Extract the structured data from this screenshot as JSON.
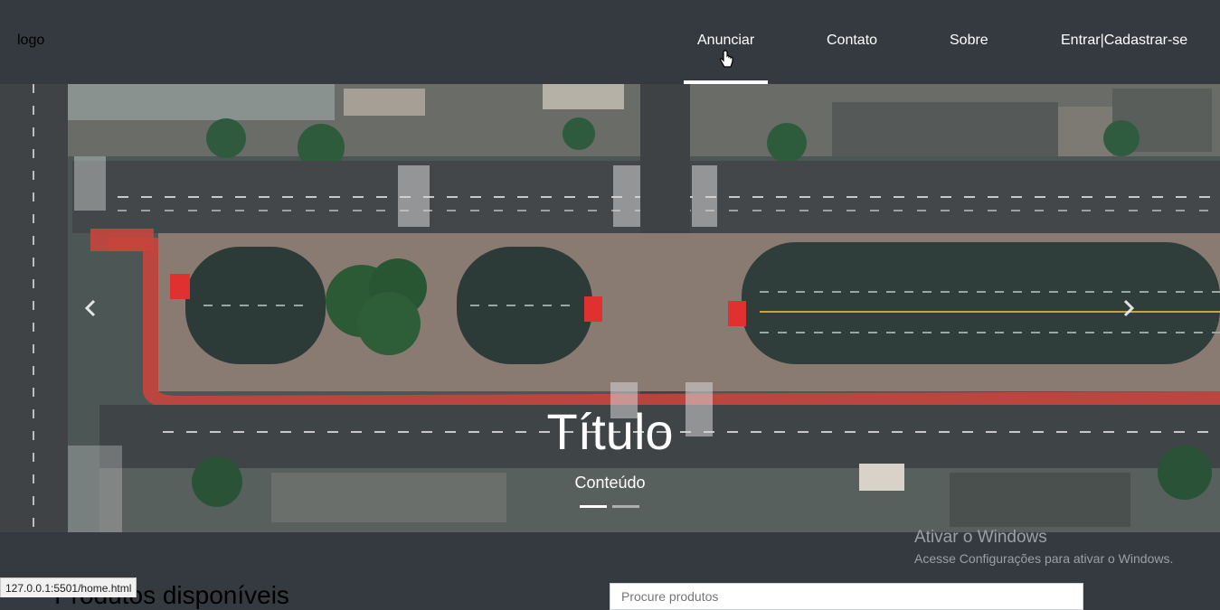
{
  "navbar": {
    "logo": "logo",
    "items": [
      {
        "label": "Anunciar",
        "active": true
      },
      {
        "label": "Contato"
      },
      {
        "label": "Sobre"
      },
      {
        "label": "Entrar|Cadastrar-se"
      }
    ]
  },
  "carousel": {
    "title": "Título",
    "content": "Conteúdo",
    "slide_count": 2,
    "active_slide": 1,
    "prev_icon": "chevron-left-icon",
    "next_icon": "chevron-right-icon"
  },
  "products": {
    "heading": "Produtos disponíveis",
    "search_placeholder": "Procure produtos"
  },
  "windows_activation": {
    "title": "Ativar o Windows",
    "subtitle": "Acesse Configurações para ativar o Windows."
  },
  "status_bar": {
    "url": "127.0.0.1:5501/home.html"
  },
  "colors": {
    "navbar_bg": "#343a40",
    "road_red": "#d9534f",
    "text_white": "#ffffff"
  }
}
